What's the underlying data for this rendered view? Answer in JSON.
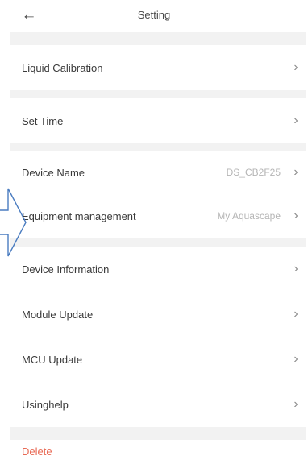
{
  "header": {
    "title": "Setting",
    "back_icon": "arrow-left-icon"
  },
  "settings": {
    "liquid_calibration": {
      "label": "Liquid Calibration"
    },
    "set_time": {
      "label": "Set Time"
    },
    "device_name": {
      "label": "Device Name",
      "value": "DS_CB2F25"
    },
    "equipment_management": {
      "label": "Equipment management",
      "value": "My Aquascape"
    },
    "device_information": {
      "label": "Device Information"
    },
    "module_update": {
      "label": "Module Update"
    },
    "mcu_update": {
      "label": "MCU Update"
    },
    "usinghelp": {
      "label": "Usinghelp"
    },
    "delete": {
      "label": "Delete"
    }
  },
  "icons": {
    "row_chevron": "chevron-right-icon",
    "annotation": "arrow-right-outline-icon"
  },
  "colors": {
    "background": "#ffffff",
    "section_gap": "#f2f2f2",
    "delete_text": "#e86a55",
    "value_text": "#b5b5b5",
    "annotation_arrow": "#4a7cc0"
  }
}
